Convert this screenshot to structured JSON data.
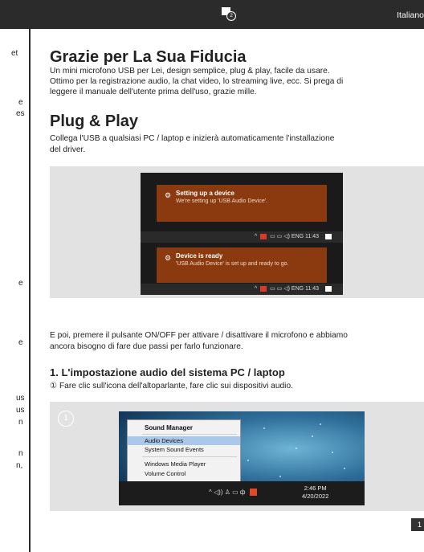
{
  "header": {
    "language": "Italiano"
  },
  "left_margin": {
    "fragments": [
      "et",
      "e",
      "es",
      "e",
      "e",
      "us",
      "us",
      "n",
      "n",
      "n,"
    ]
  },
  "section_thanks": {
    "title": "Grazie per La Sua Fiducia",
    "lines": [
      "Un mini microfono USB per Lei, design semplice, plug & play, facile da usare.",
      "Ottimo per la registrazione audio, la chat video, lo streaming live, ecc. Si prega di",
      "leggere il manuale dell'utente prima dell'uso, grazie mille."
    ]
  },
  "section_plug": {
    "title": "Plug & Play",
    "lines": [
      "Collega l'USB a qualsiasi PC / laptop e inizierà automaticamente l'installazione",
      "del driver."
    ]
  },
  "figure_notifications": {
    "toast1": {
      "title": "Setting up a device",
      "body": "We're setting up 'USB Audio Device'."
    },
    "toast2": {
      "title": "Device is ready",
      "body": "'USB Audio Device' is set up and ready to go."
    },
    "tray": {
      "lang": "ENG",
      "time": "11:43"
    }
  },
  "after_figure": {
    "lines": [
      "E poi, premere il pulsante ON/OFF per attivare / disattivare il microfono e abbiamo",
      "ancora bisogno di fare due passi per farlo funzionare."
    ]
  },
  "section_setup": {
    "title": "1. L'impostazione audio del sistema PC / laptop",
    "step1": "① Fare clic sull'icona dell'altoparlante, fare clic sui dispositivi audio."
  },
  "figure_menu": {
    "badge": "1",
    "menu_items": [
      "Sound Manager",
      "Audio Devices",
      "System Sound Events",
      "Windows Media Player",
      "Volume Control"
    ],
    "clock_time": "2:46 PM",
    "clock_date": "4/20/2022",
    "notif_count": "2"
  },
  "page_number": "1"
}
